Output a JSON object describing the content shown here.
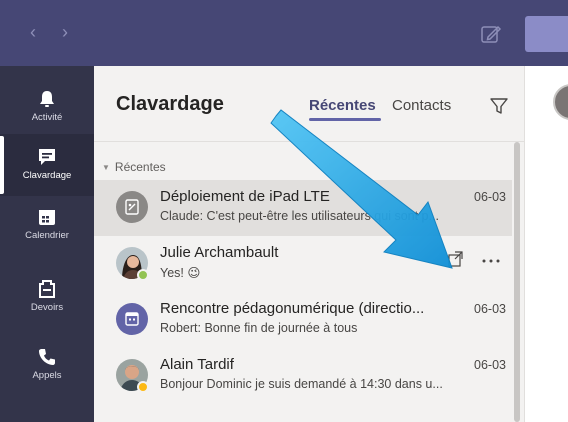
{
  "nav": {
    "back": "‹",
    "forward": "›"
  },
  "rail": {
    "items": [
      {
        "label": "Activité",
        "icon": "bell-icon",
        "active": false
      },
      {
        "label": "Clavardage",
        "icon": "chat-icon",
        "active": true
      },
      {
        "label": "Calendrier",
        "icon": "calendar-icon",
        "active": false
      },
      {
        "label": "Devoirs",
        "icon": "assignments-icon",
        "active": false
      },
      {
        "label": "Appels",
        "icon": "phone-icon",
        "active": false
      }
    ]
  },
  "panel": {
    "title": "Clavardage",
    "tabs": [
      {
        "label": "Récentes",
        "active": true
      },
      {
        "label": "Contacts",
        "active": false
      }
    ],
    "section": "Récentes",
    "chats": [
      {
        "name": "Déploiement de iPad LTE",
        "date": "06-03",
        "message": "Claude: C'est peut-être les utilisateurs qui sont p...",
        "selected": true,
        "avatar": "group-chat-icon"
      },
      {
        "name": "Julie Archambault",
        "date": "",
        "message": "Yes! 😉",
        "selected": false,
        "avatar": "photo",
        "status": "available"
      },
      {
        "name": "Rencontre pédagonumérique (directio...",
        "date": "06-03",
        "message": "Robert: Bonne fin de journée à tous",
        "selected": false,
        "avatar": "meeting-icon"
      },
      {
        "name": "Alain Tardif",
        "date": "06-03",
        "message": "Bonjour Dominic je suis demandé à 14:30 dans u...",
        "selected": false,
        "avatar": "photo",
        "status": "away"
      }
    ]
  },
  "colors": {
    "brand": "#464775",
    "rail": "#33344a",
    "accent": "#6264a7",
    "arrow": "#1aa3e8",
    "available": "#92c353",
    "away": "#fdb913"
  }
}
